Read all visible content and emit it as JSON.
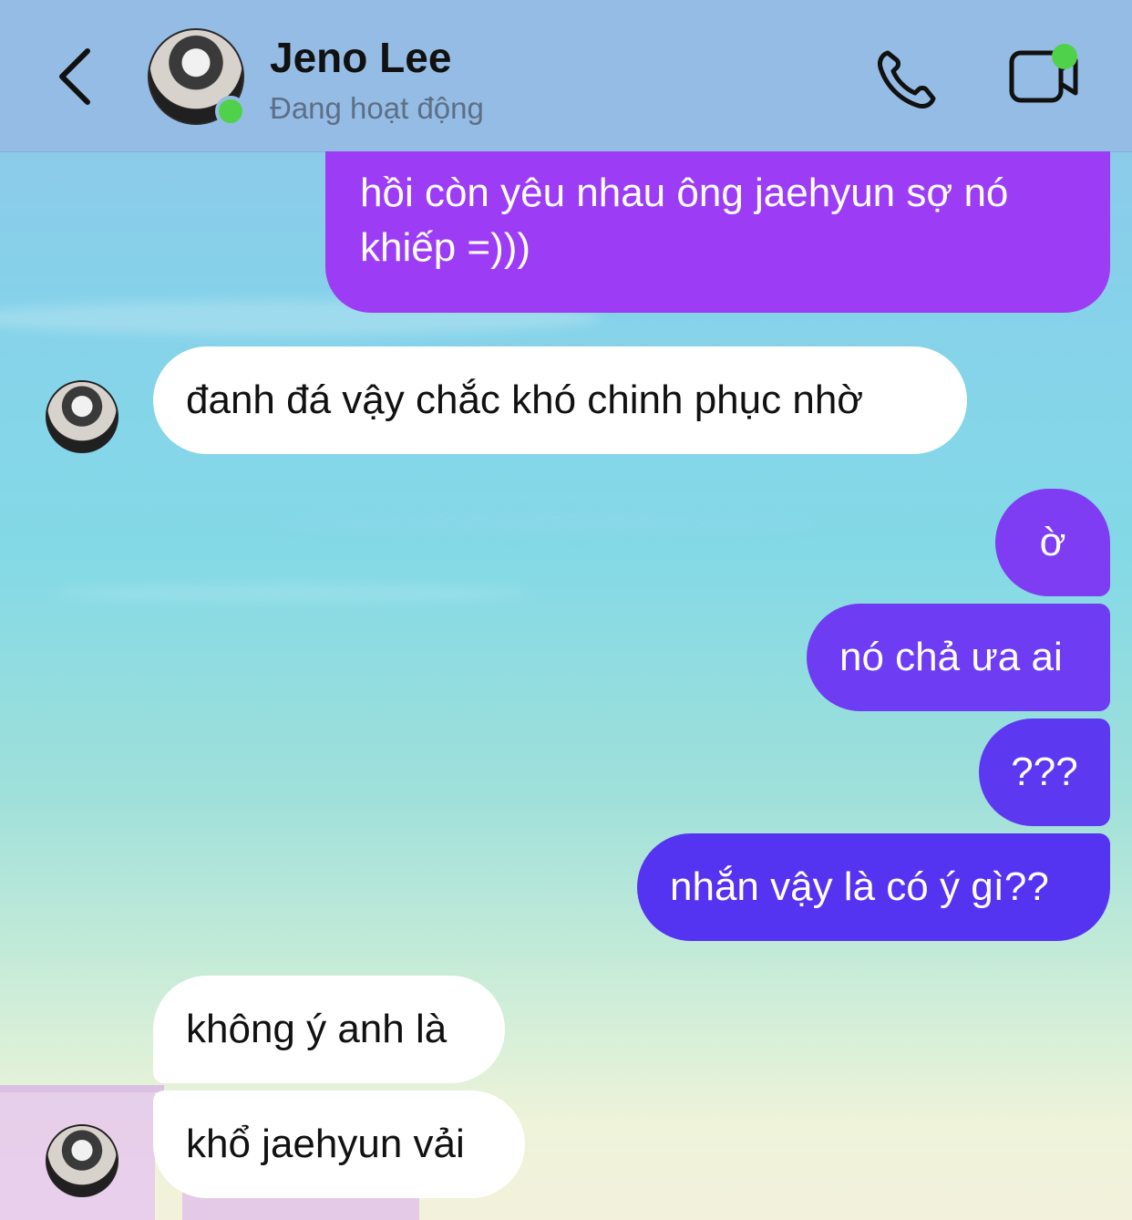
{
  "header": {
    "contact_name": "Jeno Lee",
    "status": "Đang hoạt động",
    "back_icon": "chevron-left-icon",
    "call_icon": "phone-icon",
    "video_icon": "video-camera-icon",
    "online_color": "#4fd24a"
  },
  "messages": [
    {
      "side": "out",
      "text": "hồi còn yêu nhau ông jaehyun sợ nó khiếp =)))"
    },
    {
      "side": "in",
      "text": "đanh đá vậy chắc khó chinh phục nhờ"
    },
    {
      "side": "out",
      "text": "ờ"
    },
    {
      "side": "out",
      "text": "nó chả ưa ai"
    },
    {
      "side": "out",
      "text": "???"
    },
    {
      "side": "out",
      "text": "nhắn vậy là có ý gì??"
    },
    {
      "side": "in",
      "text": "không ý anh là"
    },
    {
      "side": "in",
      "text": "khổ jaehyun vải"
    }
  ],
  "colors": {
    "out_bubble_top": "#9b3ef5",
    "out_bubble_bottom": "#5533f0",
    "in_bubble": "#ffffff"
  }
}
